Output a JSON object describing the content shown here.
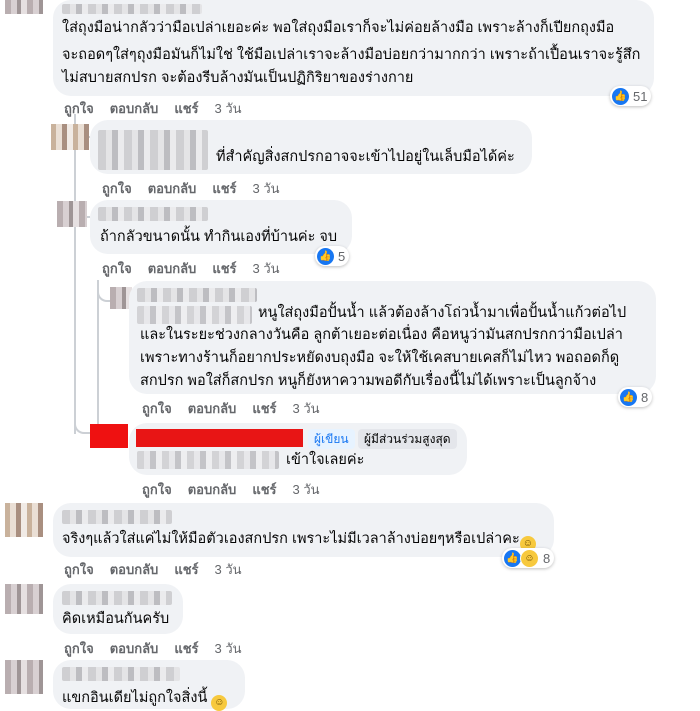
{
  "comments": [
    {
      "id": "c1",
      "lines": [
        "ใส่ถุงมือน่ากลัวว่ามือเปล่าเยอะค่ะ พอใส่ถุงมือเราก็จะไม่ค่อยล้างมือ เพราะล้างก็เปียกถุงมือ",
        "จะถอดๆใส่ๆถุงมือมันก็ไม่ใช่ ใช้มือเปล่าเราจะล้างมือบ่อยกว่ามากกว่า เพราะถ้าเปื้อนเราจะรู้สึก",
        "ไม่สบายสกปรก จะต้องรีบล้างมันเป็นปฏิกิริยาของร่างกาย"
      ],
      "like": "ถูกใจ",
      "reply": "ตอบกลับ",
      "share": "แชร์",
      "time": "3 วัน",
      "reaction_count": "51"
    },
    {
      "id": "r1",
      "text": "ที่สำคัญสิ่งสกปรกอาจจะเข้าไปอยู่ในเล็บมือได้ค่ะ",
      "like": "ถูกใจ",
      "reply": "ตอบกลับ",
      "share": "แชร์",
      "time": "3 วัน"
    },
    {
      "id": "r2",
      "text": "ถ้ากลัวขนาดนั้น ทำกินเองที่บ้านค่ะ จบ",
      "like": "ถูกใจ",
      "reply": "ตอบกลับ",
      "share": "แชร์",
      "time": "3 วัน",
      "reaction_count": "5"
    },
    {
      "id": "r3",
      "lines": [
        "หนูใส่ถุงมือปั้นน้ำ แล้วต้องล้างโถ่วน้ำมาเพื่อปั้นน้ำแก้วต่อไป",
        "และในระยะช่วงกลางวันคือ ลูกต้าเยอะต่อเนื่อง คือหนูว่ามันสกปรกกว่ามือเปล่า",
        "เพราะทางร้านก็อยากประหยัดงบถุงมือ จะให้ใช้เคสบายเคสก็ไม่ไหว พอถอดก็ดู",
        "สกปรก พอใส่ก็สกปรก หนูก็ยังหาความพอดีกับเรื่องนี้ไม่ได้เพราะเป็นลูกจ้าง"
      ],
      "like": "ถูกใจ",
      "reply": "ตอบกลับ",
      "share": "แชร์",
      "time": "3 วัน",
      "reaction_count": "8"
    },
    {
      "id": "r4",
      "badge_author": "ผู้เขียน",
      "badge_top": "ผู้มีส่วนร่วมสูงสุด",
      "text": "เข้าใจเลยค่ะ",
      "like": "ถูกใจ",
      "reply": "ตอบกลับ",
      "share": "แชร์",
      "time": "3 วัน"
    },
    {
      "id": "c2",
      "text": "จริงๆแล้วใส่แค่ไม่ให้มือตัวเองสกปรก เพราะไม่มีเวลาล้างบ่อยๆหรือเปล่าคะ",
      "emoji": "😂",
      "like": "ถูกใจ",
      "reply": "ตอบกลับ",
      "share": "แชร์",
      "time": "3 วัน",
      "reaction_count": "8"
    },
    {
      "id": "c3",
      "text": "คิดเหมือนกันครับ",
      "like": "ถูกใจ",
      "reply": "ตอบกลับ",
      "share": "แชร์",
      "time": "3 วัน"
    },
    {
      "id": "c4",
      "text": "แขกอินเดียไม่ถูกใจสิ่งนี้",
      "emoji": "😆"
    }
  ],
  "icons": {
    "like": "like-reaction-icon",
    "haha": "haha-reaction-icon"
  }
}
